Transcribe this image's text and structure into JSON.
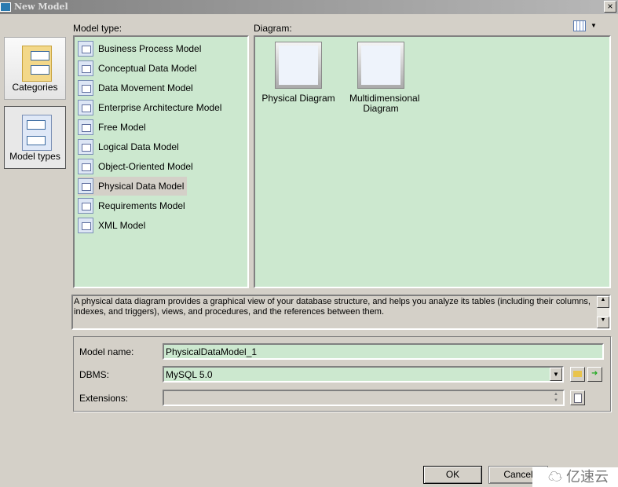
{
  "window": {
    "title": "New Model",
    "close": "×"
  },
  "categories": [
    {
      "label": "Categories",
      "selected": false
    },
    {
      "label": "Model types",
      "selected": true
    }
  ],
  "model_type": {
    "label": "Model type:",
    "items": [
      {
        "label": "Business Process Model"
      },
      {
        "label": "Conceptual Data Model"
      },
      {
        "label": "Data Movement Model"
      },
      {
        "label": "Enterprise Architecture Model"
      },
      {
        "label": "Free Model"
      },
      {
        "label": "Logical Data Model"
      },
      {
        "label": "Object-Oriented Model"
      },
      {
        "label": "Physical Data Model",
        "selected": true
      },
      {
        "label": "Requirements Model"
      },
      {
        "label": "XML Model"
      }
    ]
  },
  "diagram": {
    "label": "Diagram:",
    "items": [
      {
        "label": "Physical Diagram"
      },
      {
        "label": "Multidimensional Diagram"
      }
    ],
    "view_icon": "grid-view-icon"
  },
  "description": "A physical data diagram provides a graphical view of your database structure, and helps you analyze its tables (including their columns, indexes, and triggers), views, and procedures, and the references between them.",
  "form": {
    "model_name_label": "Model name:",
    "model_name": "PhysicalDataModel_1",
    "dbms_label": "DBMS:",
    "dbms": "MySQL 5.0",
    "extensions_label": "Extensions:",
    "extensions": ""
  },
  "buttons": {
    "ok": "OK",
    "cancel": "Cancel"
  },
  "watermark": "亿速云",
  "colors": {
    "list_bg": "#cce8cf",
    "dialog_bg": "#d4d0c8"
  }
}
